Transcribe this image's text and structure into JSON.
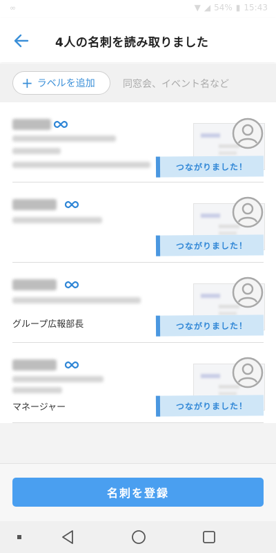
{
  "status_bar": {
    "left": "∞",
    "battery": "54%",
    "time": "15:43"
  },
  "header": {
    "title": "4人の名刺を読み取りました",
    "back_icon": "arrow-left-icon"
  },
  "label_bar": {
    "add_label": "ラベルを追加",
    "placeholder": "同窓会、イベント名など"
  },
  "cards": [
    {
      "job_title": "",
      "connected_label": "つながりました！"
    },
    {
      "job_title": "",
      "connected_label": "つながりました！"
    },
    {
      "job_title": "グループ広報部長",
      "connected_label": "つながりました！"
    },
    {
      "job_title": "マネージャー",
      "connected_label": "つながりました！"
    }
  ],
  "footer": {
    "register_label": "名刺を登録"
  },
  "colors": {
    "accent": "#4a9ff0",
    "link_icon": "#2f86d6",
    "connected_bg": "#cfe6f7"
  }
}
